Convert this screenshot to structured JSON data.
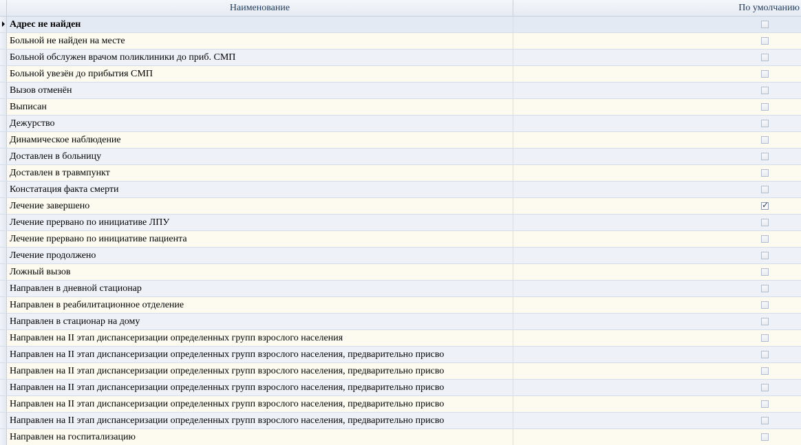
{
  "columns": {
    "name": "Наименование",
    "default": "По умолчанию"
  },
  "icons": {
    "row_indicator": "current-row-arrow-icon",
    "check": "checkmark-icon"
  },
  "rows": [
    {
      "name": "Адрес не найден",
      "default": false,
      "selected": true
    },
    {
      "name": "Больной не найден на месте",
      "default": false
    },
    {
      "name": "Больной обслужен врачом поликлиники до приб. СМП",
      "default": false
    },
    {
      "name": "Больной увезён до прибытия СМП",
      "default": false
    },
    {
      "name": "Вызов отменён",
      "default": false
    },
    {
      "name": "Выписан",
      "default": false
    },
    {
      "name": "Дежурство",
      "default": false
    },
    {
      "name": "Динамическое наблюдение",
      "default": false
    },
    {
      "name": "Доставлен в больницу",
      "default": false
    },
    {
      "name": "Доставлен в травмпункт",
      "default": false
    },
    {
      "name": "Констатация факта смерти",
      "default": false
    },
    {
      "name": "Лечение завершено",
      "default": true
    },
    {
      "name": "Лечение прервано по инициативе ЛПУ",
      "default": false
    },
    {
      "name": "Лечение прервано по инициативе пациента",
      "default": false
    },
    {
      "name": "Лечение продолжено",
      "default": false
    },
    {
      "name": "Ложный вызов",
      "default": false
    },
    {
      "name": "Направлен в дневной стационар",
      "default": false
    },
    {
      "name": "Направлен в реабилитационное отделение",
      "default": false
    },
    {
      "name": "Направлен в стационар на дому",
      "default": false
    },
    {
      "name": "Направлен на II этап диспансеризации определенных групп взрослого населения",
      "default": false
    },
    {
      "name": "Направлен на II этап диспансеризации определенных групп взрослого населения, предварительно присво",
      "default": false
    },
    {
      "name": "Направлен на II этап диспансеризации определенных групп взрослого населения, предварительно присво",
      "default": false
    },
    {
      "name": "Направлен на II этап диспансеризации определенных групп взрослого населения, предварительно присво",
      "default": false
    },
    {
      "name": "Направлен на II этап диспансеризации определенных групп взрослого населения, предварительно присво",
      "default": false
    },
    {
      "name": "Направлен на II этап диспансеризации определенных групп взрослого населения, предварительно присво",
      "default": false
    },
    {
      "name": "Направлен на госпитализацию",
      "default": false
    }
  ]
}
